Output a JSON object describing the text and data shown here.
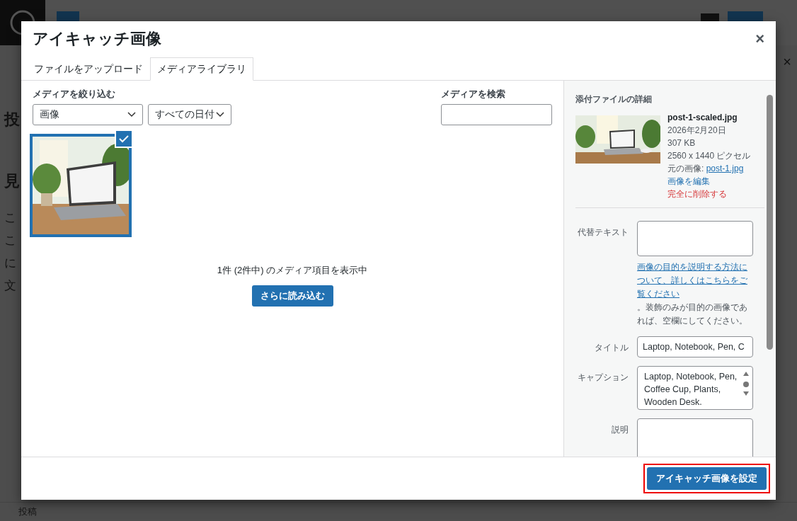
{
  "editor_background": {
    "side_texts": [
      "投",
      "見",
      "こ",
      "こ",
      "に",
      "文"
    ],
    "panel_close": "×",
    "status_bar": "投稿"
  },
  "dialog": {
    "title": "アイキャッチ画像",
    "close": "×",
    "tabs": [
      {
        "label": "ファイルをアップロード",
        "selected": false
      },
      {
        "label": "メディアライブラリ",
        "selected": true
      }
    ],
    "filter": {
      "label": "メディアを絞り込む",
      "type_select": "画像",
      "date_select": "すべての日付"
    },
    "search": {
      "label": "メディアを検索"
    },
    "media_items": [
      {
        "kind": "picture",
        "selected": true
      }
    ],
    "count_text": "1件 (2件中) のメディア項目を表示中",
    "load_more": "さらに読み込む",
    "details": {
      "heading": "添付ファイルの詳細",
      "filename": "post-1-scaled.jpg",
      "date": "2026年2月20日",
      "size": "307 KB",
      "dimensions": "2560 x 1440 ピクセル",
      "original_label": "元の画像:",
      "original_link": "post-1.jpg",
      "edit_link": "画像を編集",
      "delete_link": "完全に削除する",
      "fields": [
        {
          "label": "代替テキスト",
          "kind": "textarea",
          "help_link": "画像の目的を説明する方法について、詳しくはこちらをご覧ください",
          "help_text": "。装飾のみが目的の画像であれば、空欄にしてください。"
        },
        {
          "label": "タイトル",
          "kind": "input",
          "value": "Laptop, Notebook, Pen, C"
        },
        {
          "label": "キャプション",
          "kind": "textarea",
          "value": "Laptop, Notebook, Pen, Coffee Cup, Plants, Wooden Desk."
        },
        {
          "label": "説明",
          "kind": "textarea"
        }
      ]
    },
    "button": {
      "label": "アイキャッチ画像を設定",
      "highlighted": true
    }
  }
}
